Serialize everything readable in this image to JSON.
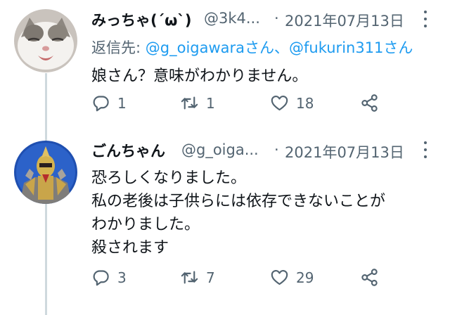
{
  "tweets": [
    {
      "name": "みっちゃ(´ω`)",
      "handle": "@3k4...",
      "separator": "·",
      "date": "2021年07月13日",
      "reply_label": "返信先:",
      "reply_mention_1": "@g_oigawaraさん",
      "reply_joiner": "、",
      "reply_mention_2": "@fukurin311さん",
      "lines": [
        "娘さん？意味がわかりません。"
      ],
      "reply_count": "1",
      "retweet_count": "1",
      "like_count": "18"
    },
    {
      "name": "ごんちゃん",
      "handle": "@g_oiga...",
      "separator": "·",
      "date": "2021年07月13日",
      "lines": [
        "恐ろしくなりました。",
        "私の老後は子供らには依存できないことが",
        "わかりました。",
        "殺されます"
      ],
      "reply_count": "3",
      "retweet_count": "7",
      "like_count": "29"
    }
  ],
  "icons": {
    "avatar_1": "cat-avatar",
    "avatar_2": "armored-hero-avatar",
    "reply": "reply-icon",
    "retweet": "retweet-icon",
    "like": "heart-icon",
    "share": "share-icon",
    "more": "more-icon"
  },
  "colors": {
    "mention": "#1d9bf0",
    "secondary_text": "#536471",
    "thread_line": "#cfd9de"
  }
}
